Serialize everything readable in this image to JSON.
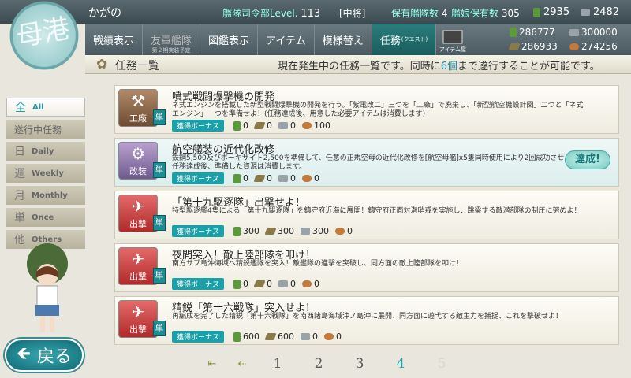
{
  "player": {
    "name": "かがの",
    "level_label": "艦隊司令部Level.",
    "level": "113",
    "rank": "[中将]",
    "fleet_label": "保有艦隊数",
    "fleet": "4",
    "ships_label": "艦娘保有数",
    "ships": "305"
  },
  "top_resources": {
    "buckets": "2935",
    "dev": "2482"
  },
  "nav": {
    "tabs": [
      {
        "label": "戦績表示",
        "sub": ""
      },
      {
        "label": "友軍艦隊",
        "sub": "－第２期実装予定－"
      },
      {
        "label": "図鑑表示",
        "sub": ""
      },
      {
        "label": "アイテム",
        "sub": ""
      },
      {
        "label": "模様替え",
        "sub": ""
      },
      {
        "label": "任務",
        "sub": "(クエスト)"
      }
    ],
    "item_shop": "アイテム屋"
  },
  "resources": {
    "fuel": "286777",
    "ammo": "286933",
    "steel": "300000",
    "baux": "274256"
  },
  "emblem": "母港",
  "header": {
    "title": "任務一覧",
    "info_pre": "現在発生中の任務一覧です。同時に",
    "info_num": "6個",
    "info_post": "まで遂行することが可能です。"
  },
  "filters": [
    {
      "k": "全",
      "e": "All"
    },
    {
      "k": "遂行中任務",
      "e": ""
    },
    {
      "k": "日",
      "e": "Daily"
    },
    {
      "k": "週",
      "e": "Weekly"
    },
    {
      "k": "月",
      "e": "Monthly"
    },
    {
      "k": "単",
      "e": "Once"
    },
    {
      "k": "他",
      "e": "Others"
    }
  ],
  "quests": [
    {
      "cat": "工廠",
      "type": "単",
      "title": "噴式戦闘爆撃機の開発",
      "desc": "ネ式エンジンを搭載した新型戦闘爆撃機の開発を行う。「紫電改二」三つを「工廠」で廃棄し、「新型航空機設計図」二つと「ネ式エンジン」一つを準備せよ！(任務達成後、用意した必要アイテムは消費します)",
      "bonus": "獲得ボーナス",
      "fuel": "0",
      "ammo": "0",
      "steel": "0",
      "baux": "100",
      "done": ""
    },
    {
      "cat": "改装",
      "type": "単",
      "title": "航空艤装の近代化改修",
      "desc": "鉄鋼5,500及びボーキサイト2,500を準備して、任意の正規空母の近代化改修を[航空母艦]x5隻同時使用により2回成功させよ！※任務達成後、準備した資源は消費します。",
      "bonus": "獲得ボーナス",
      "fuel": "0",
      "ammo": "0",
      "steel": "0",
      "baux": "0",
      "done": "達成!"
    },
    {
      "cat": "出撃",
      "type": "単",
      "title": "「第十九駆逐隊」出撃せよ！",
      "desc": "特型駆逐艦4隻による「第十九駆逐隊」を鎮守府近海に展開！鎮守府正面対潜哨戒を実施し、跳梁する敵潜部隊の制圧に努めよ！",
      "bonus": "獲得ボーナス",
      "fuel": "300",
      "ammo": "300",
      "steel": "300",
      "baux": "0",
      "done": ""
    },
    {
      "cat": "出撃",
      "type": "単",
      "title": "夜間突入！敵上陸部隊を叩け！",
      "desc": "南方サブ島沖海域へ精鋭艦隊を突入！敵艦隊の進撃を突破し、同方面の敵上陸部隊を叩け！",
      "bonus": "獲得ボーナス",
      "fuel": "0",
      "ammo": "0",
      "steel": "0",
      "baux": "0",
      "done": ""
    },
    {
      "cat": "出撃",
      "type": "単",
      "title": "精鋭「第十六戦隊」突入せよ！",
      "desc": "再編成を完了した精鋭「第十六戦隊」を南西諸島海域沖ノ島沖に展開、同方面に遊弋する敵主力を捕捉、これを撃破せよ！",
      "bonus": "獲得ボーナス",
      "fuel": "600",
      "ammo": "600",
      "steel": "0",
      "baux": "0",
      "done": ""
    }
  ],
  "pager": [
    "1",
    "2",
    "3",
    "4",
    "5"
  ],
  "back_label": "戻る",
  "colors": {
    "accent": "#27a2ad",
    "teal": "#1b8d95"
  }
}
